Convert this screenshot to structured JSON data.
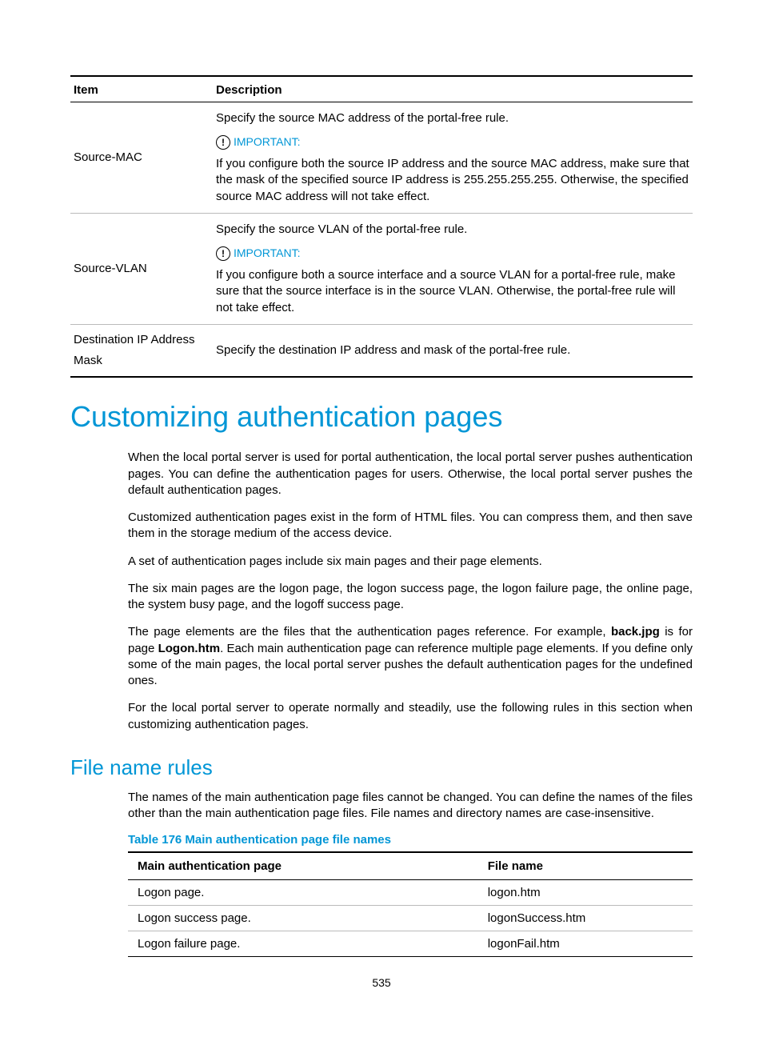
{
  "table1": {
    "headers": {
      "item": "Item",
      "description": "Description"
    },
    "rows": [
      {
        "item": "Source-MAC",
        "desc_top": "Specify the source MAC address of the portal-free rule.",
        "important": "IMPORTANT:",
        "desc_body": "If you configure both the source IP address and the source MAC address, make sure that the mask of the specified source IP address is 255.255.255.255. Otherwise, the specified source MAC address will not take effect."
      },
      {
        "item": "Source-VLAN",
        "desc_top": "Specify the source VLAN of the portal-free rule.",
        "important": "IMPORTANT:",
        "desc_body": "If you configure both a source interface and a source VLAN for a portal-free rule, make sure that the source interface is in the source VLAN. Otherwise, the portal-free rule will not take effect."
      },
      {
        "item1": "Destination IP Address",
        "item2": "Mask",
        "desc": "Specify the destination IP address and mask of the portal-free rule."
      }
    ]
  },
  "heading1": "Customizing authentication pages",
  "paragraphs": {
    "p1": "When the local portal server is used for portal authentication, the local portal server pushes authentication pages. You can define the authentication pages for users. Otherwise, the local portal server pushes the default authentication pages.",
    "p2": "Customized authentication pages exist in the form of HTML files. You can compress them, and then save them in the storage medium of the access device.",
    "p3": "A set of authentication pages include six main pages and their page elements.",
    "p4": "The six main pages are the logon page, the logon success page, the logon failure page, the online page, the system busy page, and the logoff success page.",
    "p5a": "The page elements are the files that the authentication pages reference. For example, ",
    "p5b": "back.jpg",
    "p5c": " is for page ",
    "p5d": "Logon.htm",
    "p5e": ". Each main authentication page can reference multiple page elements. If you define only some of the main pages, the local portal server pushes the default authentication pages for the undefined ones.",
    "p6": "For the local portal server to operate normally and steadily, use the following rules in this section when customizing authentication pages."
  },
  "heading2": "File name rules",
  "paragraphs2": {
    "p7": "The names of the main authentication page files cannot be changed. You can define the names of the files other than the main authentication page files. File names and directory names are case-insensitive."
  },
  "table2": {
    "caption": "Table 176 Main authentication page file names",
    "headers": {
      "page": "Main authentication page",
      "file": "File name"
    },
    "rows": [
      {
        "page": "Logon page.",
        "file": "logon.htm"
      },
      {
        "page": "Logon success page.",
        "file": "logonSuccess.htm"
      },
      {
        "page": "Logon failure page.",
        "file": "logonFail.htm"
      }
    ]
  },
  "page_number": "535",
  "important_glyph": "!"
}
